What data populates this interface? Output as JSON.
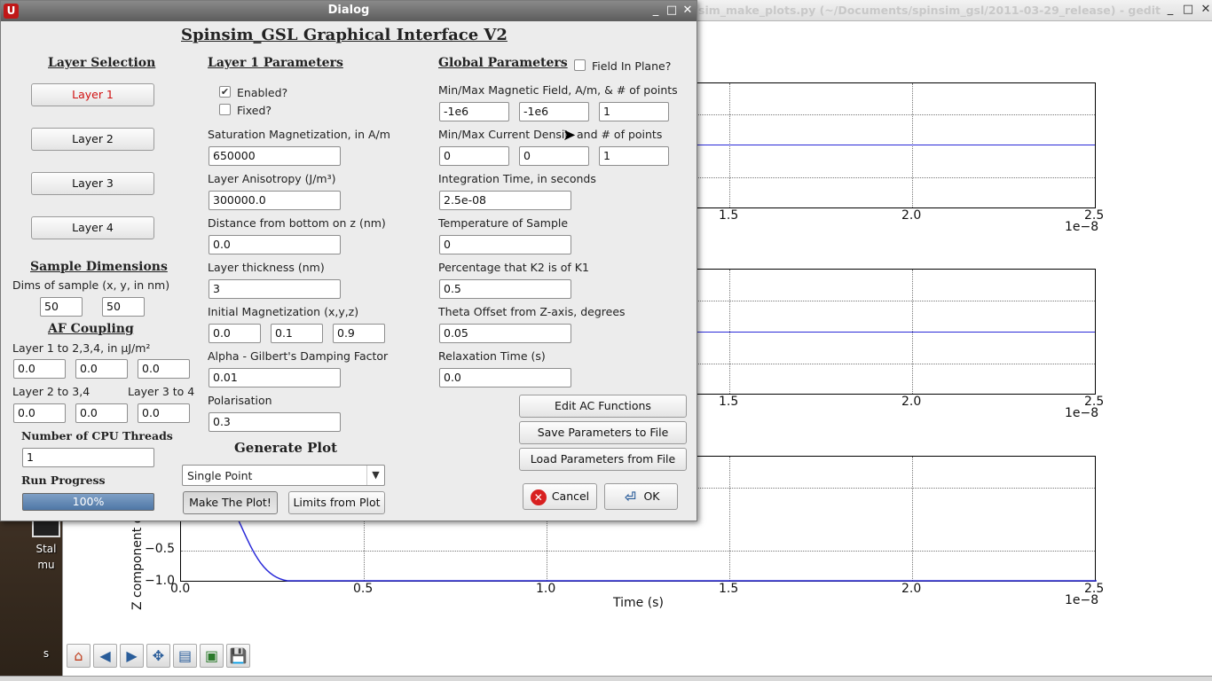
{
  "desktop": {
    "icon_label_1": "Stal",
    "icon_label_2": "mu",
    "icon_label_3": "s"
  },
  "plot_window": {
    "title": "sim_make_plots.py (~/Documents/spinsim_gsl/2011-03-29_release) - gedit",
    "x_ticks": [
      "0.0",
      "0.5",
      "1.0",
      "1.5",
      "2.0",
      "2.5"
    ],
    "x_ticks_visible_top": [
      "1.5",
      "2.0",
      "2.5"
    ],
    "x_offset": "1e−8",
    "y_ticks_bottom": [
      "−0.5",
      "−1.0"
    ],
    "y_tick_partial": "0.0",
    "x_label": "Time (s)",
    "y_label": "Z component o",
    "toolbar_icons": [
      "home-icon",
      "back-icon",
      "forward-icon",
      "pan-icon",
      "configure-icon",
      "zoom-rect-icon",
      "save-icon"
    ]
  },
  "dialog": {
    "window_title": "Dialog",
    "main_title": "Spinsim_GSL Graphical Interface V2",
    "layer_selection": {
      "heading": "Layer Selection",
      "buttons": [
        "Layer 1",
        "Layer 2",
        "Layer 3",
        "Layer 4"
      ]
    },
    "sample_dims": {
      "heading": "Sample Dimensions",
      "label": "Dims of sample (x, y, in nm)",
      "x": "50",
      "y": "50"
    },
    "af_coupling": {
      "heading": "AF Coupling",
      "label_1": "Layer 1 to 2,3,4, in μJ/m²",
      "row1": [
        "0.0",
        "0.0",
        "0.0"
      ],
      "label_2": "Layer 2 to 3,4",
      "label_3": "Layer 3 to 4",
      "row2": [
        "0.0",
        "0.0",
        "0.0"
      ]
    },
    "cpu": {
      "label": "Number of CPU Threads",
      "value": "1"
    },
    "run_progress": {
      "label": "Run Progress",
      "value_text": "100%",
      "value": 1.0
    },
    "layer_params": {
      "heading": "Layer 1 Parameters",
      "enabled_label": "Enabled?",
      "enabled": true,
      "fixed_label": "Fixed?",
      "fixed": false,
      "sat_mag_label": "Saturation Magnetization, in A/m",
      "sat_mag": "650000",
      "anisotropy_label": "Layer Anisotropy (J/m³)",
      "anisotropy": "300000.0",
      "distance_label": "Distance from bottom on z (nm)",
      "distance": "0.0",
      "thickness_label": "Layer thickness (nm)",
      "thickness": "3",
      "init_mag_label": "Initial Magnetization (x,y,z)",
      "init_mag": [
        "0.0",
        "0.1",
        "0.9"
      ],
      "alpha_label": "Alpha - Gilbert's Damping Factor",
      "alpha": "0.01",
      "polarisation_label": "Polarisation",
      "polarisation": "0.3"
    },
    "generate_plot": {
      "heading": "Generate Plot",
      "mode": "Single Point",
      "make_plot_label": "Make The Plot!",
      "limits_label": "Limits from Plot"
    },
    "global_params": {
      "heading": "Global Parameters",
      "field_in_plane_label": "Field In Plane?",
      "field_in_plane": false,
      "mag_field_label": "Min/Max Magnetic Field, A/m, & # of points",
      "mag_field": [
        "-1e6",
        "-1e6",
        "1"
      ],
      "current_label": "Min/Max Current Densit",
      "current_label_tail": "and # of points",
      "current": [
        "0",
        "0",
        "1"
      ],
      "integration_label": "Integration Time, in seconds",
      "integration": "2.5e-08",
      "temperature_label": "Temperature of Sample",
      "temperature": "0",
      "k2_label": "Percentage that K2 is of K1",
      "k2": "0.5",
      "theta_label": "Theta Offset from Z-axis, degrees",
      "theta": "0.05",
      "relax_label": "Relaxation Time (s)",
      "relax": "0.0"
    },
    "actions": {
      "edit_ac": "Edit AC Functions",
      "save_params": "Save Parameters to File",
      "load_params": "Load Parameters from File",
      "cancel": "Cancel",
      "ok": "OK"
    }
  }
}
